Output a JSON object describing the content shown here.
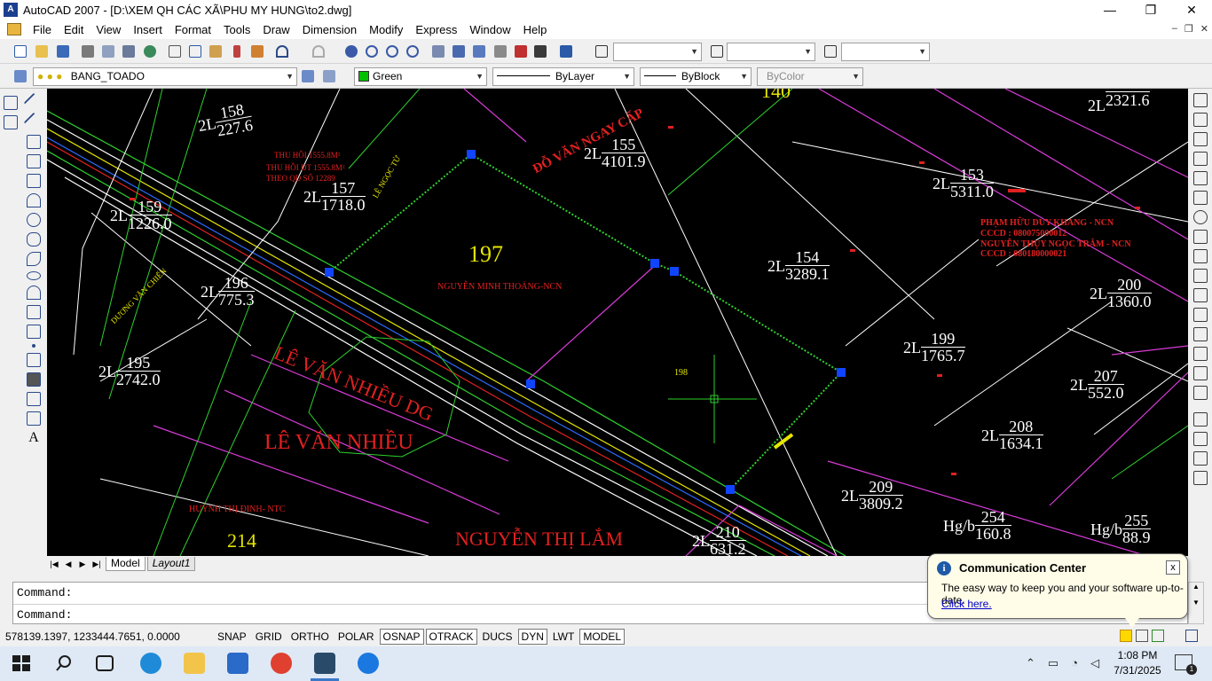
{
  "window": {
    "title": "AutoCAD 2007 - [D:\\XEM QH CÁC XÃ\\PHU MY HUNG\\to2.dwg]",
    "app_icon_letter": "A",
    "minimize": "—",
    "maximize": "❐",
    "close": "✕"
  },
  "menu": {
    "items": [
      "File",
      "Edit",
      "View",
      "Insert",
      "Format",
      "Tools",
      "Draw",
      "Dimension",
      "Modify",
      "Express",
      "Window",
      "Help"
    ],
    "doc_buttons": [
      "–",
      "❐",
      "✕"
    ]
  },
  "toolbar": {
    "text_style": "",
    "dim_style": "",
    "table_style": ""
  },
  "layers": {
    "current_layer": "BANG_TOADO",
    "color": "Green",
    "linetype": "ByLayer",
    "lineweight": "ByBlock",
    "plot_style": "ByColor"
  },
  "drawing": {
    "parcels": [
      {
        "prefix": "2L",
        "number": "158",
        "area": "227.6"
      },
      {
        "prefix": "2L",
        "number": "159",
        "area": "1226.0"
      },
      {
        "prefix": "2L",
        "number": "157",
        "area": "1718.0"
      },
      {
        "prefix": "2L",
        "number": "155",
        "area": "4101.9"
      },
      {
        "prefix": "2L",
        "number": "196",
        "area": "775.3"
      },
      {
        "prefix": "2L",
        "number": "195",
        "area": "2742.0"
      },
      {
        "prefix": "2L",
        "number": "153",
        "area": "5311.0"
      },
      {
        "prefix": "2L",
        "number": "154",
        "area": "3289.1"
      },
      {
        "prefix": "2L",
        "number": "199",
        "area": "1765.7"
      },
      {
        "prefix": "2L",
        "number": "200",
        "area": "1360.0"
      },
      {
        "prefix": "2L",
        "number": "207",
        "area": "552.0"
      },
      {
        "prefix": "2L",
        "number": "208",
        "area": "1634.1"
      },
      {
        "prefix": "2L",
        "number": "209",
        "area": "3809.2"
      },
      {
        "prefix": "2L",
        "number": "210",
        "area": "631.2"
      },
      {
        "prefix": "2L",
        "number": "",
        "area": "2321.6"
      },
      {
        "prefix": "Hg/b",
        "number": "254",
        "area": "160.8"
      },
      {
        "prefix": "Hg/b",
        "number": "255",
        "area": "88.9"
      }
    ],
    "owner_labels": {
      "le_van_nhieu_dg": "LÊ VĂN NHIỀU DG",
      "le_van_nhieu": "LÊ VĂN NHIỀU",
      "nguyen_thi_lam": "NGUYỄN THỊ LẮM",
      "nguyen_minh_thoang": "NGUYỄN MINH THOẢNG-NCN",
      "do_van_ngay_cap": "ĐỖ VĂN NGAY CẤP",
      "huynh_thi_dinh": "HUỲNH THỊ ĐINH- NTC",
      "thu_hoi_1": "THU HỒI 1555.8M²",
      "thu_hoi_2": "THU HỒI ĐT 1555.8M²",
      "theo_qd": "THEO QĐ SỐ 12289",
      "pham_huu_duy_khang": "PHẠM HỮU DUY KHANG - NCN",
      "cccd_1": "CCCD : 080075000012",
      "nguyen_thuy_ngoc_tram": "NGUYỄN THỤY NGỌC TRÂM - NCN",
      "cccd_2": "CCCD : 080180000021",
      "duong_van_chien": "DƯƠNG VĂN CHIẾN",
      "le_ngoc_tu": "LÊ NGỌC TỪ",
      "parcel_214": "214",
      "parcel_198": "198",
      "parcel_197": "197",
      "parcel_top": "140"
    }
  },
  "tabs": {
    "model": "Model",
    "layout": "Layout1"
  },
  "command": {
    "line1": "Command:",
    "line2": "Command:"
  },
  "status": {
    "coordinates": "578139.1397, 1233444.7651, 0.0000",
    "buttons": [
      "SNAP",
      "GRID",
      "ORTHO",
      "POLAR",
      "OSNAP",
      "OTRACK",
      "DUCS",
      "DYN",
      "LWT",
      "MODEL"
    ],
    "active_buttons": [
      "OSNAP",
      "OTRACK",
      "DYN",
      "MODEL"
    ]
  },
  "communication_center": {
    "title": "Communication Center",
    "body": "The easy way to keep you and your software up-to-date.",
    "link": "Click here.",
    "close": "x"
  },
  "taskbar": {
    "time": "1:08 PM",
    "date": "7/31/2025",
    "notification_count": "1"
  },
  "colors": {
    "canvas_bg": "#000000",
    "parcel_line_green": "#2fd02f",
    "parcel_line_magenta": "#d83bd8",
    "road_red": "#e22020",
    "owner_text_red": "#e22020",
    "grip_blue": "#1144ff"
  }
}
